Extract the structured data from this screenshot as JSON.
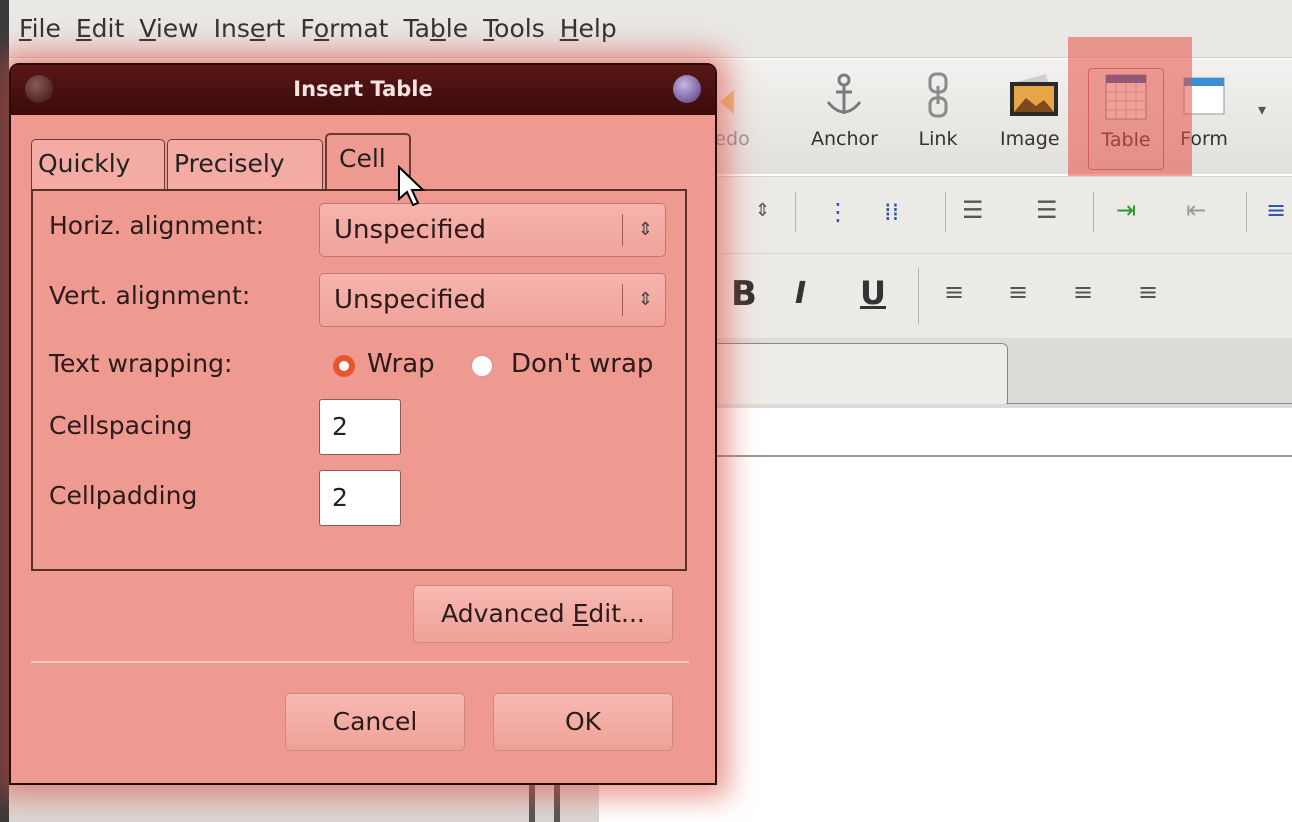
{
  "menubar": {
    "items": [
      {
        "label": "File",
        "u": "F",
        "rest": "ile"
      },
      {
        "label": "Edit",
        "u": "E",
        "rest": "dit"
      },
      {
        "label": "View",
        "u": "V",
        "rest": "iew"
      },
      {
        "label": "Insert",
        "pre": "Ins",
        "u": "e",
        "rest": "rt"
      },
      {
        "label": "Format",
        "pre": "F",
        "u": "o",
        "rest": "rmat"
      },
      {
        "label": "Table",
        "pre": "Ta",
        "u": "b",
        "rest": "le"
      },
      {
        "label": "Tools",
        "u": "T",
        "rest": "ools"
      },
      {
        "label": "Help",
        "u": "H",
        "rest": "elp"
      }
    ]
  },
  "toolbar": {
    "redo_fragment": "edo",
    "anchor": "Anchor",
    "link": "Link",
    "image": "Image",
    "table": "Table",
    "form": "Form"
  },
  "format_toolbar": {
    "bold": "B",
    "italic": "I",
    "underline": "U"
  },
  "dialog": {
    "title": "Insert Table",
    "tabs": [
      "Quickly",
      "Precisely",
      "Cell"
    ],
    "active_tab": "Cell",
    "horiz_label": "Horiz. alignment:",
    "horiz_value": "Unspecified",
    "vert_label": "Vert. alignment:",
    "vert_value": "Unspecified",
    "wrap_label": "Text wrapping:",
    "wrap_option": "Wrap",
    "nowrap_option": "Don't wrap",
    "wrap_selected": "Wrap",
    "cellspacing_label": "Cellspacing",
    "cellspacing_value": "2",
    "cellpadding_label": "Cellpadding",
    "cellpadding_value": "2",
    "advanced_pre": "Advanced ",
    "advanced_u": "E",
    "advanced_post": "dit...",
    "cancel": "Cancel",
    "ok": "OK"
  },
  "colors": {
    "highlight": "#e65046",
    "dialog_bg": "#ee9a91",
    "titlebar": "#3b0a0a",
    "radio_on": "#e7552e"
  }
}
